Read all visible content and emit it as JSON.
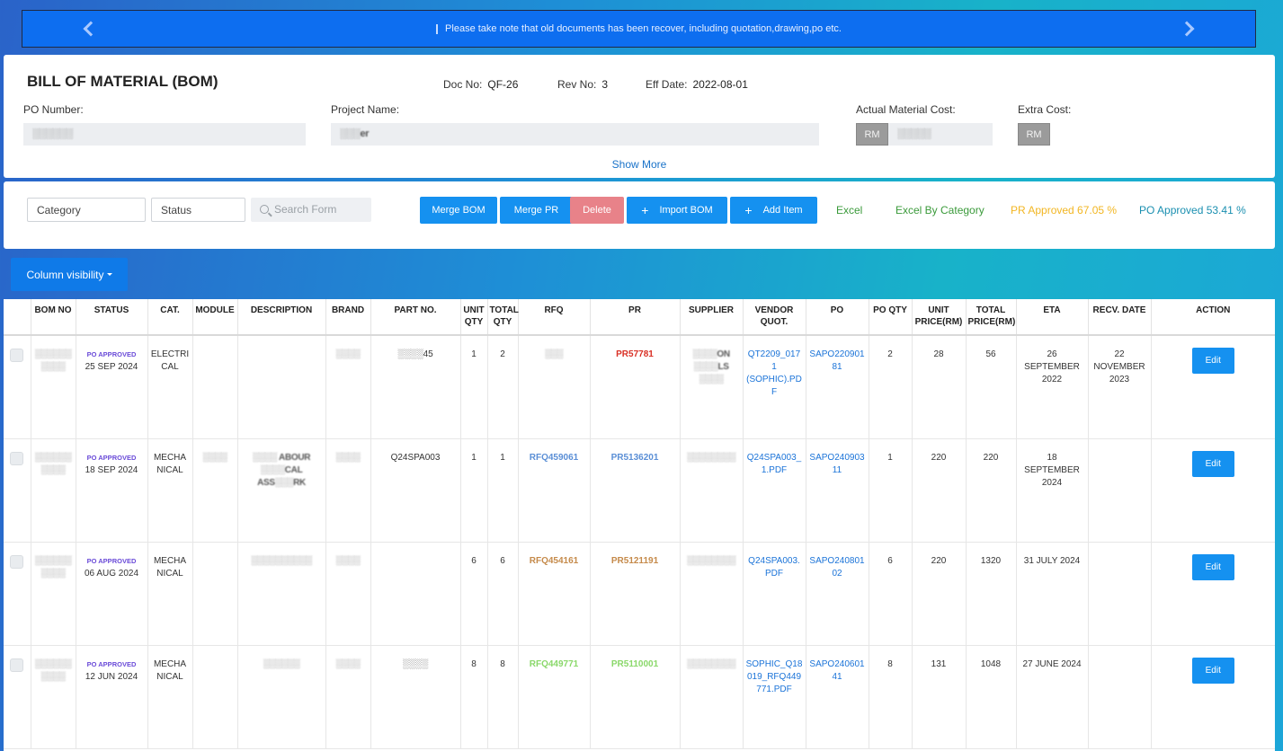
{
  "banner": {
    "message": "Please take note that old documents has been recover, including quotation,drawing,po etc."
  },
  "header": {
    "title": "BILL OF MATERIAL (BOM)",
    "doc_no_label": "Doc No:",
    "doc_no": "QF-26",
    "rev_no_label": "Rev No:",
    "rev_no": "3",
    "eff_date_label": "Eff Date:",
    "eff_date": "2022-08-01",
    "po_number_label": "PO Number:",
    "po_number_value": "░░░░░░",
    "project_name_label": "Project Name:",
    "project_name_value": "░░░er",
    "actual_cost_label": "Actual Material Cost:",
    "currency": "RM",
    "actual_cost_value": "░░░░░",
    "extra_cost_label": "Extra Cost:",
    "show_more": "Show More"
  },
  "filters": {
    "category": "Category",
    "status": "Status",
    "search_placeholder": "Search Form",
    "merge_bom": "Merge BOM",
    "merge_pr": "Merge PR",
    "delete": "Delete",
    "import_bom": "Import BOM",
    "add_item": "Add Item",
    "excel": "Excel",
    "excel_by_category": "Excel By Category",
    "pr_approved": "PR Approved 67.05 %",
    "po_approved": "PO Approved 53.41 %",
    "colors": {
      "button_blue": "#1591f0",
      "delete_pink": "#e88289",
      "excel_green": "#3a9a3a",
      "pr_yellow": "#f2b622",
      "po_teal": "#1a8fb0"
    }
  },
  "column_visibility": "Column visibility",
  "table": {
    "columns": [
      "",
      "BOM NO",
      "STATUS",
      "CAT.",
      "MODULE",
      "DESCRIPTION",
      "BRAND",
      "PART NO.",
      "UNIT QTY",
      "TOTAL QTY",
      "RFQ",
      "PR",
      "SUPPLIER",
      "VENDOR QUOT.",
      "PO",
      "PO QTY",
      "UNIT PRICE(RM)",
      "TOTAL PRICE(RM)",
      "ETA",
      "RECV. DATE",
      "ACTION"
    ],
    "rows": [
      {
        "bom_no": "░░░░░░░░░░",
        "status": "PO APPROVED",
        "status_date": "25 SEP 2024",
        "category": "ELECTRICAL",
        "module": "",
        "description": "",
        "brand": "░░░░",
        "part_no": "░░░░45",
        "unit_qty": "1",
        "total_qty": "2",
        "rfq": "░░░",
        "pr": "PR57781",
        "supplier": "░░░░ON ░░░░LS ░░░░",
        "vendor_quot": "QT2209_0171 (SOPHIC).PDF",
        "po": "SAPO22090181",
        "po_qty": "2",
        "unit_price": "28",
        "total_price": "56",
        "eta": "26 SEPTEMBER 2022",
        "recv_date": "22 NOVEMBER 2023",
        "action": "Edit"
      },
      {
        "bom_no": "░░░░░░░░░░",
        "status": "PO APPROVED",
        "status_date": "18 SEP 2024",
        "category": "MECHANICAL",
        "module": "░░░░",
        "description": "░░░░ ABOUR ░░░░CAL ASS░░░RK",
        "brand": "░░░░",
        "part_no": "Q24SPA003",
        "unit_qty": "1",
        "total_qty": "1",
        "rfq": "RFQ459061",
        "pr": "PR5136201",
        "supplier": "░░░░░░░░",
        "vendor_quot": "Q24SPA003_1.PDF",
        "po": "SAPO24090311",
        "po_qty": "1",
        "unit_price": "220",
        "total_price": "220",
        "eta": "18 SEPTEMBER 2024",
        "recv_date": "",
        "action": "Edit"
      },
      {
        "bom_no": "░░░░░░░░░░",
        "status": "PO APPROVED",
        "status_date": "06 AUG 2024",
        "category": "MECHANICAL",
        "module": "",
        "description": "░░░░░░░░░░",
        "brand": "░░░░",
        "part_no": "",
        "unit_qty": "6",
        "total_qty": "6",
        "rfq": "RFQ454161",
        "pr": "PR5121191",
        "supplier": "░░░░░░░░",
        "vendor_quot": "Q24SPA003.PDF",
        "po": "SAPO24080102",
        "po_qty": "6",
        "unit_price": "220",
        "total_price": "1320",
        "eta": "31 JULY 2024",
        "recv_date": "",
        "action": "Edit"
      },
      {
        "bom_no": "░░░░░░░░░░",
        "status": "PO APPROVED",
        "status_date": "12 JUN 2024",
        "category": "MECHANICAL",
        "module": "",
        "description": "░░░░░░",
        "brand": "░░░░",
        "part_no": "░░░░",
        "unit_qty": "8",
        "total_qty": "8",
        "rfq": "RFQ449771",
        "pr": "PR5110001",
        "supplier": "░░░░░░░░",
        "vendor_quot": "SOPHIC_Q18019_RFQ449771.PDF",
        "po": "SAPO24060141",
        "po_qty": "8",
        "unit_price": "131",
        "total_price": "1048",
        "eta": "27 JUNE 2024",
        "recv_date": "",
        "action": "Edit"
      }
    ]
  }
}
